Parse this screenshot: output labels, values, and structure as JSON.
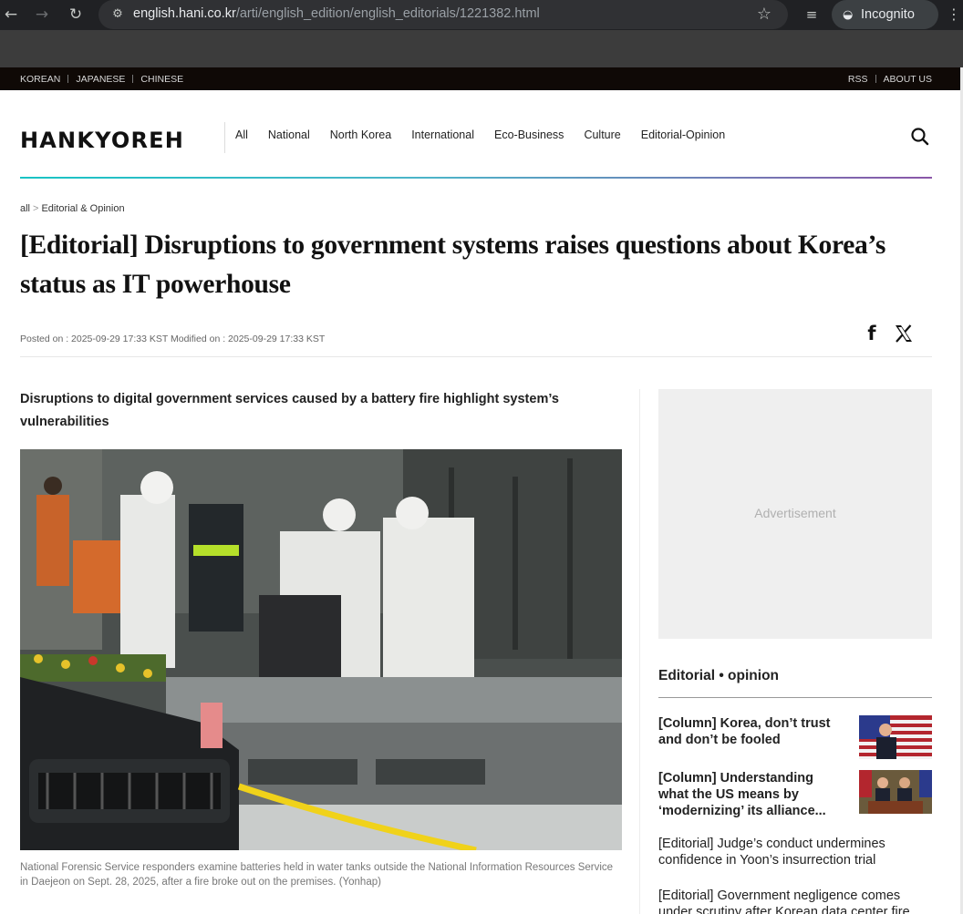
{
  "browser": {
    "url_host": "english.hani.co.kr",
    "url_path": "/arti/english_edition/english_editorials/1221382.html",
    "incognito_label": "Incognito",
    "icons": [
      "back-arrow-icon",
      "forward-arrow-icon",
      "reload-icon",
      "site-settings-icon",
      "bookmark-star-icon",
      "media-controls-icon",
      "incognito-icon",
      "kebab-menu-icon"
    ]
  },
  "topbar": {
    "languages": [
      "KOREAN",
      "JAPANESE",
      "CHINESE"
    ],
    "rss": "RSS",
    "about": "ABOUT US"
  },
  "header": {
    "logo": "HANKYOREH",
    "nav": [
      "All",
      "National",
      "North Korea",
      "International",
      "Eco-Business",
      "Culture",
      "Editorial-Opinion"
    ],
    "icons": [
      "search-icon"
    ],
    "accent_gradient": [
      "#18c3c4",
      "#8a56a8"
    ]
  },
  "article": {
    "breadcrumb_home": "all",
    "breadcrumb_section": "Editorial & Opinion",
    "headline": "[Editorial] Disruptions to government systems raises questions about Korea’s status as IT powerhouse",
    "meta": "Posted on : 2025-09-29 17:33 KST Modified on : 2025-09-29 17:33 KST",
    "share_icons": [
      "facebook-icon",
      "x-twitter-icon"
    ],
    "subhead": "Disruptions to digital government services caused by a battery fire highlight system’s vulnerabilities",
    "caption": "National Forensic Service responders examine batteries held in water tanks outside the National Information Resources Service in Daejeon on Sept. 28, 2025, after a fire broke out on the premises. (Yonhap)"
  },
  "sidebar": {
    "ad_label": "Advertisement",
    "section_title": "Editorial • opinion",
    "items": [
      {
        "title": "[Column] Korea, don’t trust and don’t be fooled",
        "bold": true,
        "thumb": true
      },
      {
        "title": "[Column] Understanding what the US means by ‘modernizing’ its alliance...",
        "bold": true,
        "thumb": true
      },
      {
        "title": "[Editorial] Judge’s conduct undermines confidence in Yoon’s insurrection trial",
        "bold": false,
        "thumb": false
      },
      {
        "title": "[Editorial] Government negligence comes under scrutiny after Korean data center fire",
        "bold": false,
        "thumb": false
      }
    ]
  }
}
